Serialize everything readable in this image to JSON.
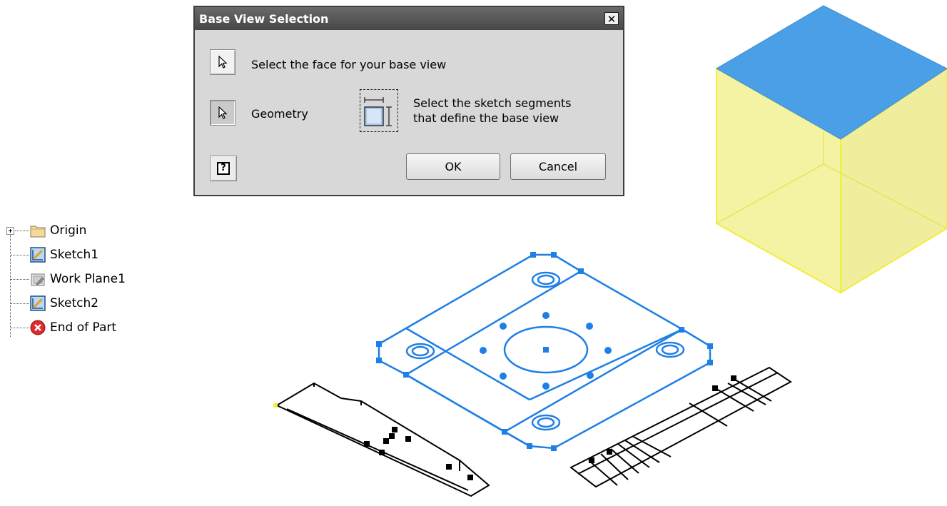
{
  "dialog": {
    "title": "Base View Selection",
    "close_label": "✕",
    "face_prompt": "Select the face for your base view",
    "geometry_label": "Geometry",
    "segments_prompt_line1": "Select the sketch segments",
    "segments_prompt_line2": "that define the base view",
    "help_label": "?",
    "ok_label": "OK",
    "cancel_label": "Cancel"
  },
  "browser": {
    "items": [
      {
        "label": "Origin",
        "icon": "folder-icon",
        "expandable": true
      },
      {
        "label": "Sketch1",
        "icon": "sketch-icon"
      },
      {
        "label": "Work Plane1",
        "icon": "work-plane-icon"
      },
      {
        "label": "Sketch2",
        "icon": "sketch-icon"
      },
      {
        "label": "End of Part",
        "icon": "end-of-part-icon"
      }
    ]
  },
  "colors": {
    "selected_sketch": "#1e7fe6",
    "solid_top": "#4a9fe6",
    "solid_sides": "#f4f3a3",
    "solid_edges": "#f2ee3a"
  }
}
